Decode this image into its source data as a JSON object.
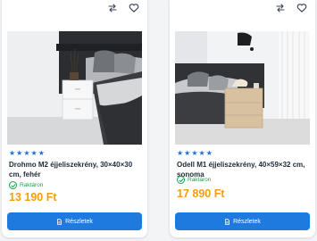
{
  "products": [
    {
      "title": "Drohmo M2 éjjeliszekrény, 30×40×30 cm, fehér",
      "stars": 5,
      "stock": "Raktáron",
      "price": "13 190 Ft",
      "button_label": "Részletek",
      "icons": [
        "compare-icon",
        "heart-icon",
        "check-icon",
        "document-icon"
      ]
    },
    {
      "title": "Odell M1 éjjeliszekrény, 40×59×32 cm, sonoma",
      "stars": 5,
      "stock": "Raktáron",
      "price": "17 890 Ft",
      "button_label": "Részletek",
      "icons": [
        "compare-icon",
        "heart-icon",
        "check-icon",
        "document-icon"
      ]
    }
  ],
  "colors": {
    "accent": "#1f7ae0",
    "stars": "#1f6fd6",
    "price": "#f59e0b",
    "stock": "#16a34a"
  }
}
